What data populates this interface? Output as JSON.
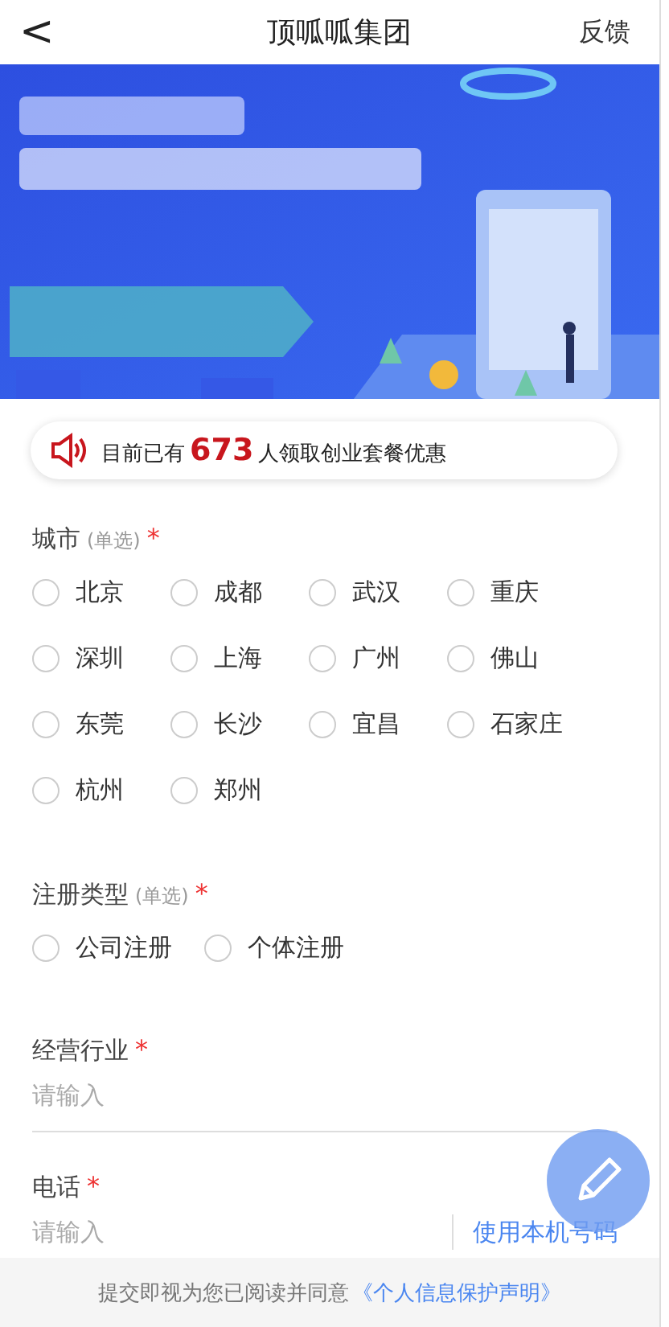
{
  "header": {
    "back": "<",
    "title": "顶呱呱集团",
    "action": "反馈"
  },
  "notice": {
    "prefix": "目前已有",
    "count": "673",
    "suffix": "人领取创业套餐优惠"
  },
  "fields": [
    {
      "kind": "radio",
      "label": "城市",
      "hint": "(单选)",
      "required_mark": "*",
      "options": [
        {
          "label": "北京",
          "selected": false
        },
        {
          "label": "成都",
          "selected": false
        },
        {
          "label": "武汉",
          "selected": false
        },
        {
          "label": "重庆",
          "selected": false
        },
        {
          "label": "深圳",
          "selected": false
        },
        {
          "label": "上海",
          "selected": false
        },
        {
          "label": "广州",
          "selected": false
        },
        {
          "label": "佛山",
          "selected": false
        },
        {
          "label": "东莞",
          "selected": false
        },
        {
          "label": "长沙",
          "selected": false
        },
        {
          "label": "宜昌",
          "selected": false
        },
        {
          "label": "石家庄",
          "selected": false
        },
        {
          "label": "杭州",
          "selected": false
        },
        {
          "label": "郑州",
          "selected": false
        }
      ]
    },
    {
      "kind": "radio",
      "label": "注册类型",
      "hint": "(单选)",
      "required_mark": "*",
      "options": [
        {
          "label": "公司注册",
          "selected": false
        },
        {
          "label": "个体注册",
          "selected": false
        }
      ]
    },
    {
      "kind": "input",
      "label": "经营行业",
      "required_mark": "*",
      "placeholder": "请输入"
    },
    {
      "kind": "input",
      "label": "电话",
      "required_mark": "*",
      "placeholder": "请输入",
      "action": "使用本机号码"
    }
  ],
  "footer": {
    "text": "提交即视为您已阅读并同意",
    "link": "《个人信息保护声明》"
  }
}
